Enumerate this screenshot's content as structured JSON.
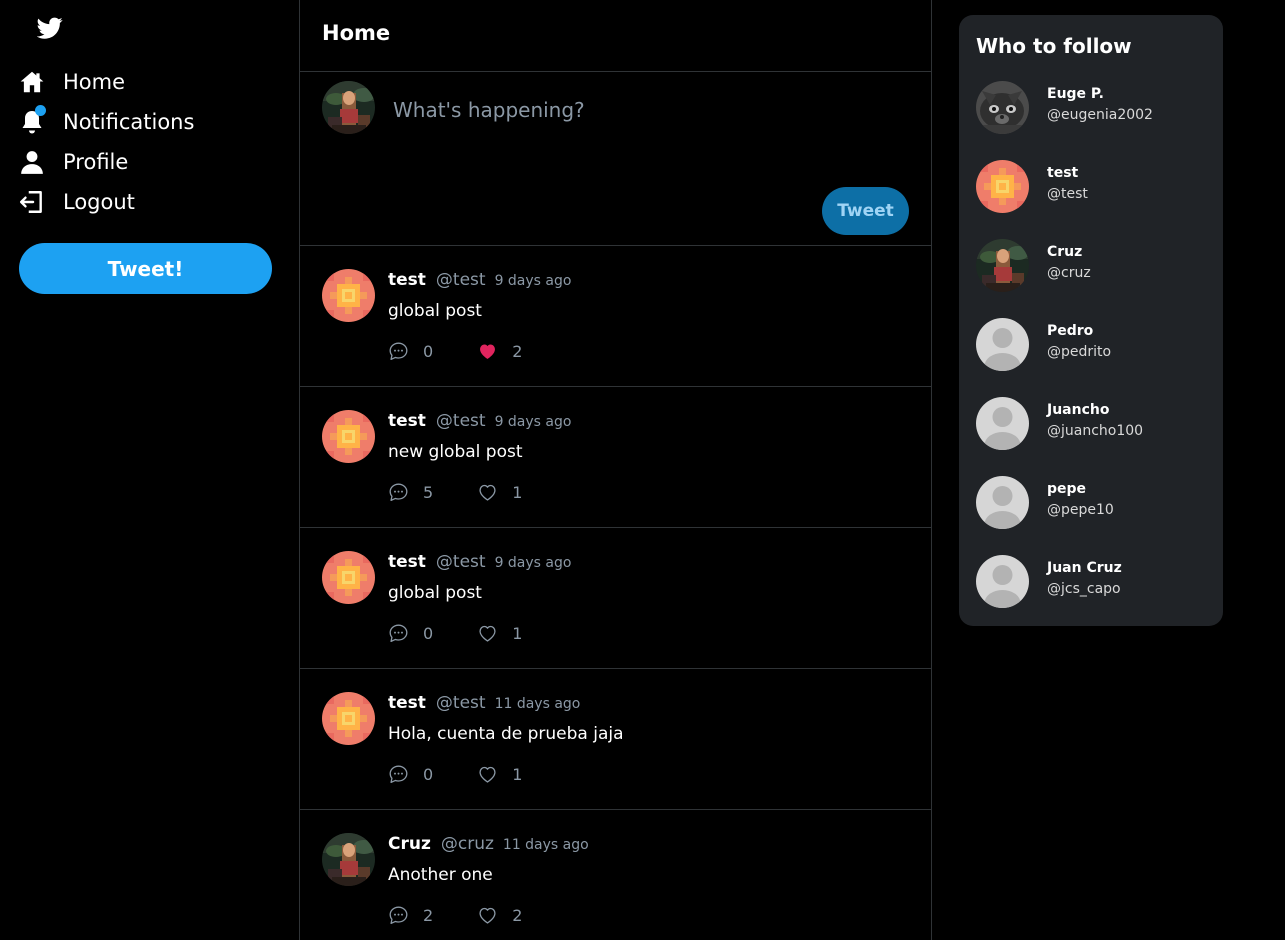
{
  "nav": {
    "items": [
      {
        "label": "Home",
        "icon": "home-icon"
      },
      {
        "label": "Notifications",
        "icon": "bell-icon"
      },
      {
        "label": "Profile",
        "icon": "user-icon"
      },
      {
        "label": "Logout",
        "icon": "logout-icon"
      }
    ],
    "tweet_button": "Tweet!"
  },
  "main": {
    "title": "Home",
    "composer": {
      "placeholder": "What's happening?",
      "button": "Tweet"
    }
  },
  "posts": [
    {
      "name": "test",
      "handle": "@test",
      "time": "9 days ago",
      "text": "global post",
      "comments": "0",
      "likes": "2",
      "liked": true,
      "avatar": "pattern"
    },
    {
      "name": "test",
      "handle": "@test",
      "time": "9 days ago",
      "text": "new global post",
      "comments": "5",
      "likes": "1",
      "liked": false,
      "avatar": "pattern"
    },
    {
      "name": "test",
      "handle": "@test",
      "time": "9 days ago",
      "text": "global post",
      "comments": "0",
      "likes": "1",
      "liked": false,
      "avatar": "pattern"
    },
    {
      "name": "test",
      "handle": "@test",
      "time": "11 days ago",
      "text": "Hola, cuenta de prueba jaja",
      "comments": "0",
      "likes": "1",
      "liked": false,
      "avatar": "pattern"
    },
    {
      "name": "Cruz",
      "handle": "@cruz",
      "time": "11 days ago",
      "text": "Another one",
      "comments": "2",
      "likes": "2",
      "liked": false,
      "avatar": "photo"
    }
  ],
  "who_to_follow": {
    "title": "Who to follow",
    "users": [
      {
        "name": "Euge P.",
        "handle": "@eugenia2002",
        "avatar": "cat"
      },
      {
        "name": "test",
        "handle": "@test",
        "avatar": "pattern"
      },
      {
        "name": "Cruz",
        "handle": "@cruz",
        "avatar": "photo"
      },
      {
        "name": "Pedro",
        "handle": "@pedrito",
        "avatar": "default"
      },
      {
        "name": "Juancho",
        "handle": "@juancho100",
        "avatar": "default"
      },
      {
        "name": "pepe",
        "handle": "@pepe10",
        "avatar": "default"
      },
      {
        "name": "Juan Cruz",
        "handle": "@jcs_capo",
        "avatar": "default"
      }
    ]
  },
  "colors": {
    "accent": "#1da1f2",
    "like_red": "#f91880",
    "panel": "#202327",
    "border": "#2f3336"
  }
}
